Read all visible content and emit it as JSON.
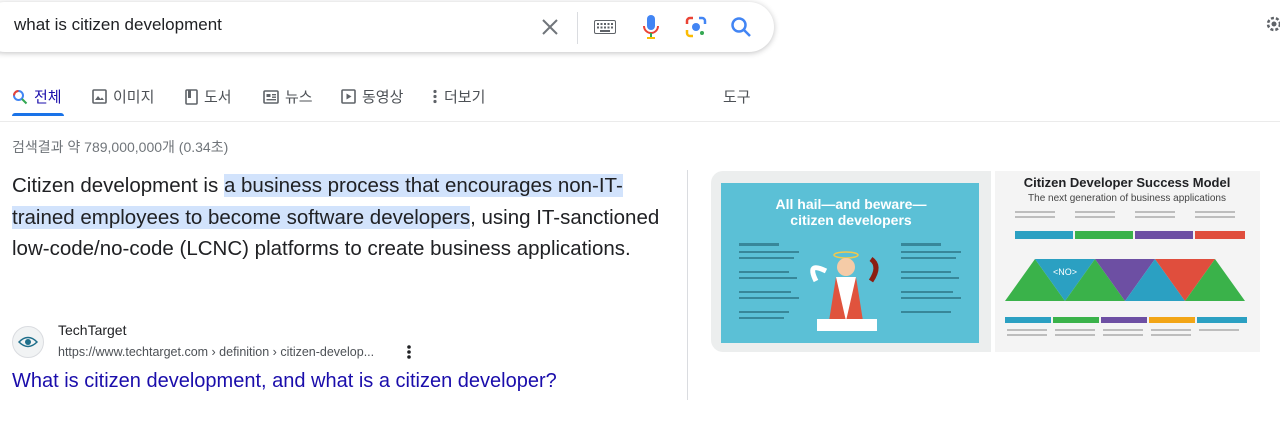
{
  "search": {
    "query": "what is citizen development"
  },
  "tabs": [
    {
      "label": "전체",
      "icon": "search-icon",
      "active": true
    },
    {
      "label": "이미지",
      "icon": "image-icon"
    },
    {
      "label": "도서",
      "icon": "book-icon"
    },
    {
      "label": "뉴스",
      "icon": "news-icon"
    },
    {
      "label": "동영상",
      "icon": "video-icon"
    },
    {
      "label": "더보기",
      "icon": "more-vert-icon"
    }
  ],
  "tools_label": "도구",
  "result_stats": "검색결과 약 789,000,000개 (0.34초)",
  "snippet": {
    "before": "Citizen development is ",
    "highlight": "a business process that encourages non-IT-trained employees to become software developers",
    "after": ", using IT-sanctioned low-code/no-code (LCNC) platforms to create business applications."
  },
  "source": {
    "site_name": "TechTarget",
    "url": "https://www.techtarget.com › definition › citizen-develop...",
    "title": "What is citizen development, and what is a citizen developer?"
  },
  "images": {
    "img1_title": "All hail—and beware—citizen developers",
    "img2_title": "Citizen Developer Success Model",
    "img2_subtitle": "The next generation of business applications",
    "img2_bands": [
      "ZERO CODE",
      "VERSATILE",
      "AGILE",
      "SCALE"
    ],
    "img2_bottom_bands": [
      "SPEED",
      "SPECIALIZED",
      "MOBILE",
      "PROCESSES",
      "PLATFORM"
    ],
    "img2_center_label": "<NO>"
  },
  "colors": {
    "accent": "#1a73e8",
    "link": "#1a0dab",
    "highlight": "#d2e3fc",
    "img1_bg": "#5bc0d6"
  }
}
